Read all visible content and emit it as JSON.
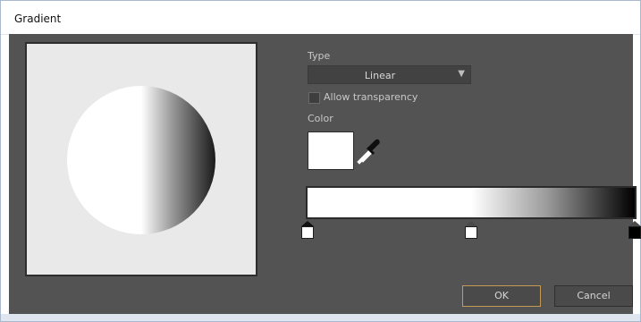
{
  "window": {
    "title": "Gradient"
  },
  "preview": {
    "shape": "circle",
    "gradient": [
      "#ffffff",
      "#000000"
    ]
  },
  "type": {
    "label": "Type",
    "value": "Linear",
    "arrow_glyph": "▼"
  },
  "transparency": {
    "label": "Allow transparency",
    "checked": false
  },
  "color": {
    "label": "Color",
    "swatch_color": "#ffffff",
    "eyedropper_icon": "eyedropper-icon"
  },
  "gradient_bar": {
    "stops": [
      {
        "position": 0.0,
        "color": "#ffffff",
        "selected": true
      },
      {
        "position": 0.5,
        "color": "#ffffff",
        "selected": false
      },
      {
        "position": 1.0,
        "color": "#000000",
        "selected": false
      }
    ]
  },
  "buttons": {
    "ok": "OK",
    "cancel": "Cancel"
  }
}
